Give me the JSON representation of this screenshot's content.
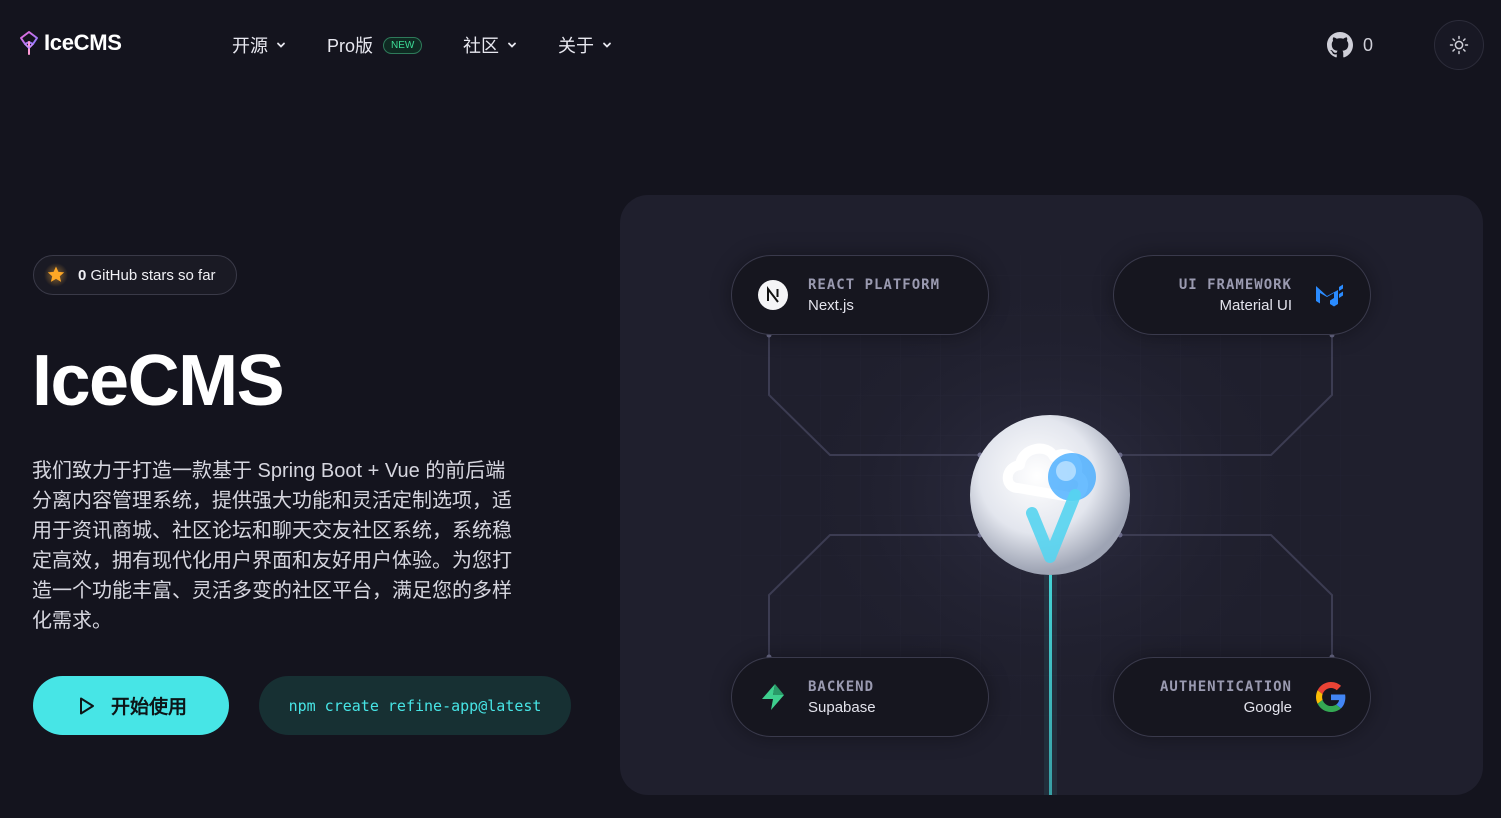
{
  "brand": {
    "name": "IceCMS"
  },
  "nav": {
    "items": [
      {
        "label": "开源",
        "has_dropdown": true
      },
      {
        "label": "Pro版",
        "badge": "NEW",
        "has_dropdown": false
      },
      {
        "label": "社区",
        "has_dropdown": true
      },
      {
        "label": "关于",
        "has_dropdown": true
      }
    ],
    "github_count": "0",
    "theme_toggle_icon": "sun-icon"
  },
  "hero": {
    "stars_pill": {
      "count": "0",
      "text": "GitHub stars so far"
    },
    "title": "IceCMS",
    "description": "我们致力于打造一款基于 Spring Boot + Vue 的前后端分离内容管理系统，提供强大功能和灵活定制选项，适用于资讯商城、社区论坛和聊天交友社区系统，系统稳定高效，拥有现代化用户界面和友好用户体验。为您打造一个功能丰富、灵活多变的社区平台，满足您的多样化需求。",
    "primary_button": "开始使用",
    "npm_command": "npm create refine-app@latest"
  },
  "diagram": {
    "cards": [
      {
        "kicker": "REACT PLATFORM",
        "title": "Next.js",
        "icon": "nextjs-icon"
      },
      {
        "kicker": "UI FRAMEWORK",
        "title": "Material UI",
        "icon": "mui-icon"
      },
      {
        "kicker": "BACKEND",
        "title": "Supabase",
        "icon": "supabase-icon"
      },
      {
        "kicker": "AUTHENTICATION",
        "title": "Google",
        "icon": "google-icon"
      }
    ],
    "center_icon": "icecms-logo-icon"
  },
  "colors": {
    "background": "#14141e",
    "accent": "#47e5e6",
    "panel": "#1f1f2d",
    "new_badge": "#3ddc97"
  }
}
